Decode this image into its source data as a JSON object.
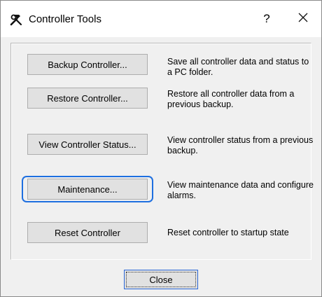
{
  "window": {
    "title": "Controller Tools",
    "help_label": "?"
  },
  "actions": [
    {
      "button": "Backup Controller...",
      "description": "Save all controller data and status to a PC folder."
    },
    {
      "button": "Restore Controller...",
      "description": "Restore all controller data from a previous backup."
    },
    {
      "button": "View Controller Status...",
      "description": "View controller status from a previous backup."
    },
    {
      "button": "Maintenance...",
      "description": "View maintenance data and configure alarms."
    },
    {
      "button": "Reset Controller",
      "description": "Reset controller to startup state"
    }
  ],
  "footer": {
    "close_label": "Close"
  },
  "colors": {
    "focus_ring": "#1e6fe0",
    "button_face": "#e1e1e1",
    "dialog_bg": "#f0f0f0"
  }
}
